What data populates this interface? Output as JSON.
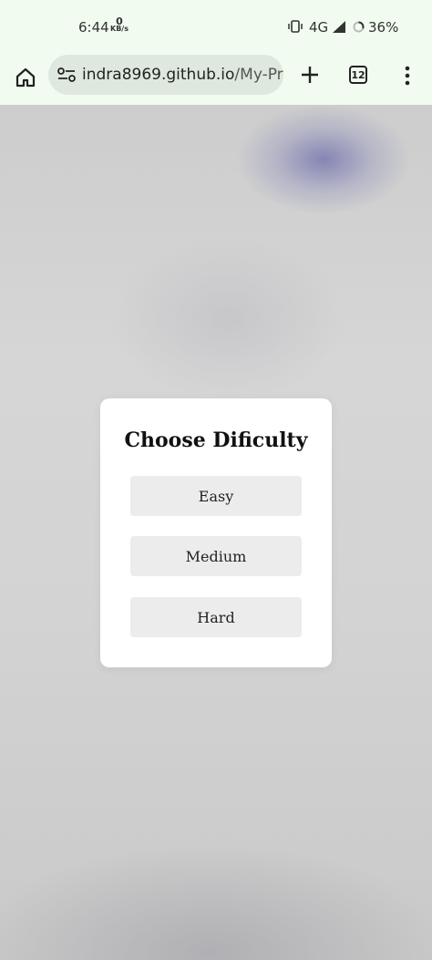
{
  "status_bar": {
    "time": "6:44",
    "net_speed_value": "0",
    "net_speed_unit": "KB/s",
    "network": "4G",
    "battery": "36%"
  },
  "browser": {
    "url_domain": "indra8969.github.io",
    "url_path": "/My-Prc",
    "tab_count": "12"
  },
  "modal": {
    "title": "Choose Dificulty",
    "options": [
      {
        "label": "Easy"
      },
      {
        "label": "Medium"
      },
      {
        "label": "Hard"
      }
    ]
  }
}
